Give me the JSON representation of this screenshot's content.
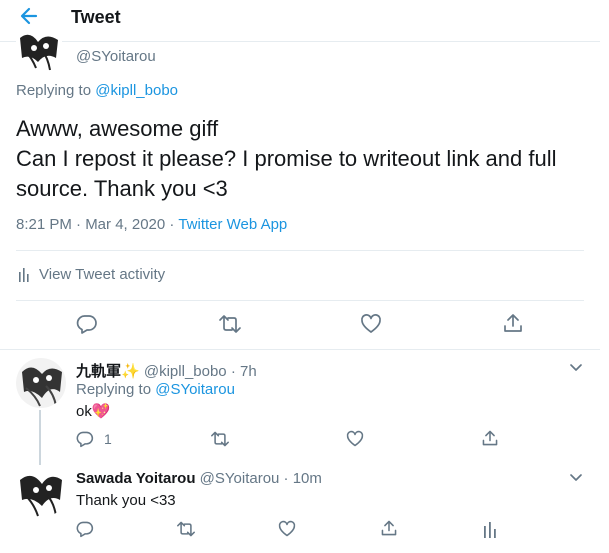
{
  "header": {
    "title": "Tweet"
  },
  "main_tweet": {
    "handle": "@SYoitarou",
    "replying_prefix": "Replying to",
    "replying_to": "@kipll_bobo",
    "text_line1": "Awww, awesome giff",
    "text_line2": "Can I repost it please? I promise to writeout link and full",
    "text_line3": "source. Thank you <3",
    "timestamp": "8:21 PM · Mar 4, 2020 ·",
    "source": "Twitter Web App",
    "activity_label": "View Tweet activity"
  },
  "reply1": {
    "name": "九軌軍",
    "name_emoji": "✨",
    "handle_time": "@kipll_bobo · 7h",
    "replying_prefix": "Replying to",
    "replying_to": "@SYoitarou",
    "text": "ok",
    "text_emoji": "💖",
    "reply_count": "1"
  },
  "reply2": {
    "name": "Sawada Yoitarou",
    "handle_time": "@SYoitarou · 10m",
    "text": "Thank you <33"
  },
  "colors": {
    "accent": "#1b95e0",
    "muted": "#657786",
    "border": "#e6ecf0"
  }
}
